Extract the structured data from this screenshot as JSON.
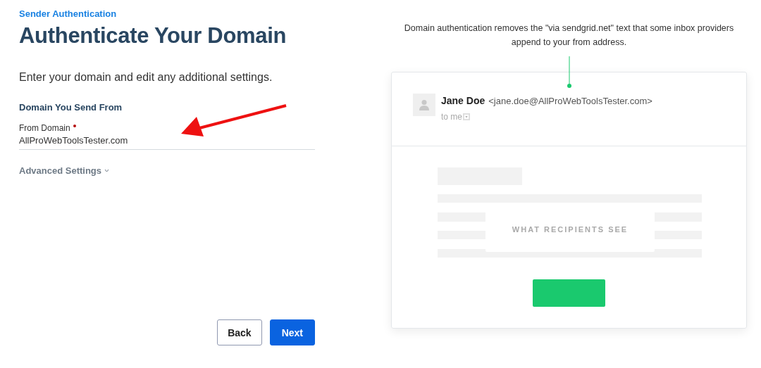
{
  "breadcrumb": "Sender Authentication",
  "title": "Authenticate Your Domain",
  "description": "Enter your domain and edit any additional settings.",
  "section_title": "Domain You Send From",
  "field": {
    "label": "From Domain",
    "required": true,
    "value": "AllProWebToolsTester.com"
  },
  "advanced_settings": {
    "label": "Advanced Settings",
    "expanded": false
  },
  "buttons": [
    {
      "label": "Back",
      "kind": "secondary"
    },
    {
      "label": "Next",
      "kind": "primary"
    }
  ],
  "preview": {
    "caption": "Domain authentication removes the \"via sendgrid.net\" text that some inbox providers append to your from address.",
    "sender_name": "Jane Doe",
    "sender_email": "<jane.doe@AllProWebToolsTester.com>",
    "recipient": "to me",
    "overlay_label": "WHAT RECIPIENTS SEE"
  }
}
